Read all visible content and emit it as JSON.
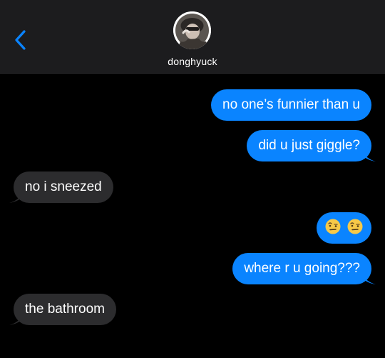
{
  "header": {
    "contact_name": "donghyuck",
    "avatar_icon": "contact-avatar-photo",
    "back_icon": "chevron-left-icon",
    "accent_color": "#0a84ff"
  },
  "messages": [
    {
      "direction": "outgoing",
      "text": "no one’s funnier than u"
    },
    {
      "direction": "outgoing",
      "text": "did u just giggle?"
    },
    {
      "direction": "incoming",
      "text": "no i sneezed"
    },
    {
      "direction": "outgoing",
      "text": "",
      "emoji": [
        "face-with-raised-eyebrow",
        "face-with-raised-eyebrow"
      ]
    },
    {
      "direction": "outgoing",
      "text": "where r u going???"
    },
    {
      "direction": "incoming",
      "text": "the bathroom"
    }
  ],
  "colors": {
    "outgoing_bubble": "#0a84ff",
    "incoming_bubble": "#2c2c2e",
    "header_bg": "#1c1c1e",
    "background": "#000000"
  }
}
